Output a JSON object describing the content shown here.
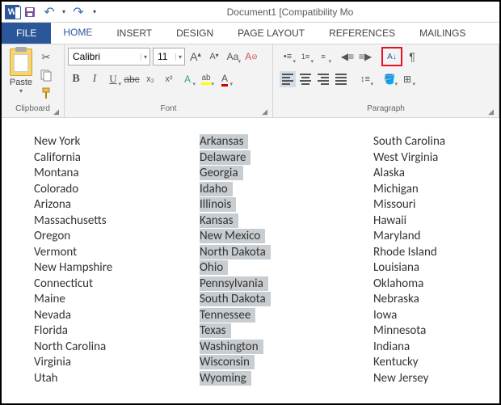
{
  "title": "Document1 [Compatibility Mo",
  "qat": {
    "save": "💾",
    "undo": "↶",
    "redo": "↷",
    "custom": "▾"
  },
  "tabs": {
    "file": "FILE",
    "items": [
      "HOME",
      "INSERT",
      "DESIGN",
      "PAGE LAYOUT",
      "REFERENCES",
      "MAILINGS"
    ],
    "activeIndex": 0
  },
  "ribbon": {
    "clipboard": {
      "label": "Clipboard",
      "paste": "Paste"
    },
    "font": {
      "label": "Font",
      "name": "Calibri",
      "size": "11",
      "grow": "A",
      "shrink": "A",
      "case": "Aa",
      "clear": "A",
      "bold": "B",
      "italic": "I",
      "underline": "U",
      "strike": "abc",
      "sub": "x₂",
      "sup": "x²",
      "effects": "A",
      "highlight": "ab",
      "color": "A"
    },
    "paragraph": {
      "label": "Paragraph",
      "sort": "A↓Z",
      "pilcrow": "¶"
    }
  },
  "doc": {
    "col1": [
      "New York",
      "California",
      "Montana",
      "Colorado",
      "Arizona",
      "Massachusetts",
      "Oregon",
      "Vermont",
      "New Hampshire",
      "Connecticut",
      "Maine",
      "Nevada",
      "Florida",
      "North Carolina",
      "Virginia",
      "Utah"
    ],
    "col2": [
      "Arkansas",
      "Delaware",
      "Georgia",
      "Idaho",
      "Illinois",
      "Kansas",
      "New Mexico",
      "North Dakota",
      "Ohio",
      "Pennsylvania",
      "South Dakota",
      "Tennessee",
      "Texas",
      "Washington",
      "Wisconsin",
      "Wyoming"
    ],
    "col3": [
      "South Carolina",
      "West Virginia",
      "Alaska",
      "Michigan",
      "Missouri",
      "Hawaii",
      "Maryland",
      "Rhode Island",
      "Louisiana",
      "Oklahoma",
      "Nebraska",
      "Iowa",
      "Minnesota",
      "Indiana",
      "Kentucky",
      "New Jersey"
    ]
  }
}
